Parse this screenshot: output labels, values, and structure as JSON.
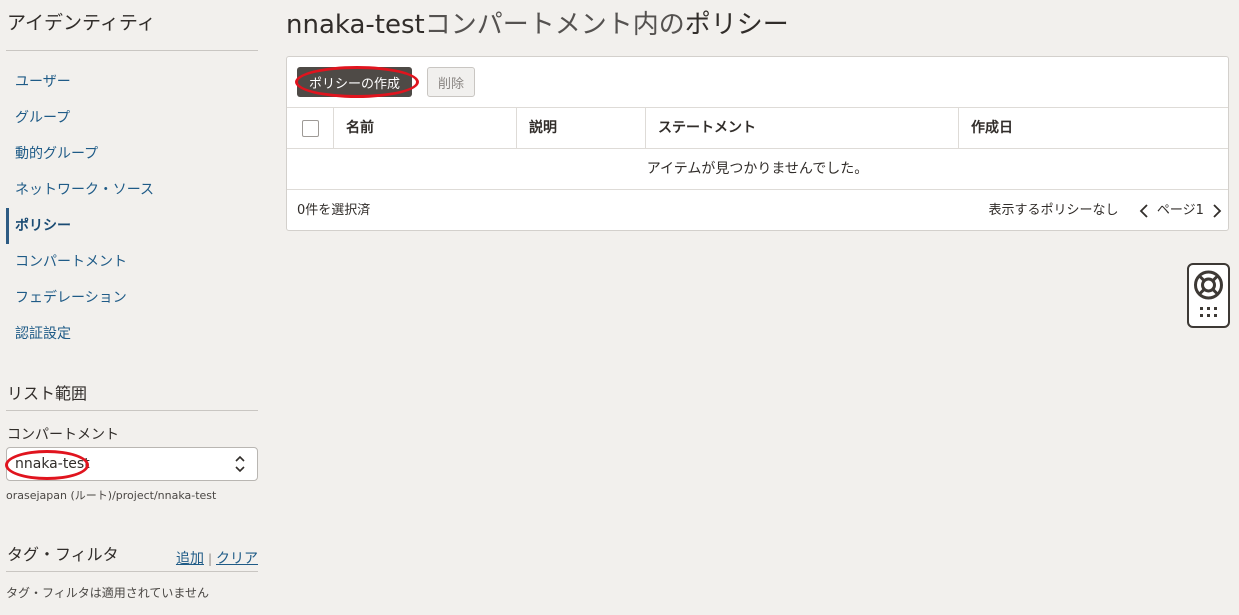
{
  "sidebar": {
    "title": "アイデンティティ",
    "items": [
      {
        "label": "ユーザー",
        "active": false
      },
      {
        "label": "グループ",
        "active": false
      },
      {
        "label": "動的グループ",
        "active": false
      },
      {
        "label": "ネットワーク・ソース",
        "active": false
      },
      {
        "label": "ポリシー",
        "active": true
      },
      {
        "label": "コンパートメント",
        "active": false
      },
      {
        "label": "フェデレーション",
        "active": false
      },
      {
        "label": "認証設定",
        "active": false
      }
    ],
    "scope": {
      "title": "リスト範囲",
      "compartment_label": "コンパートメント",
      "compartment_value": "nnaka-test",
      "compartment_path": "orasejapan (ルート)/project/nnaka-test"
    },
    "tag_filter": {
      "title": "タグ・フィルタ",
      "add_label": "追加",
      "separator": "|",
      "clear_label": "クリア",
      "note": "タグ・フィルタは適用されていません"
    }
  },
  "main": {
    "title_part1": "nnaka-test",
    "title_part2": "コンパートメント内の",
    "title_part3": "ポリシー",
    "create_button": "ポリシーの作成",
    "delete_button": "削除",
    "columns": [
      "名前",
      "説明",
      "ステートメント",
      "作成日"
    ],
    "empty_message": "アイテムが見つかりませんでした。",
    "selected_count": "0件を選択済",
    "pager_none": "表示するポリシーなし",
    "pager_page": "ページ1"
  },
  "colors": {
    "link": "#1f5b87",
    "primary_button": "#4e4a46",
    "annotation_red": "#e0141e"
  },
  "icons": {
    "select_chevron": "chevron-up-down-icon",
    "prev_page": "chevron-left-icon",
    "next_page": "chevron-right-icon",
    "help": "lifebuoy-icon",
    "apps": "grid-dots-icon"
  }
}
